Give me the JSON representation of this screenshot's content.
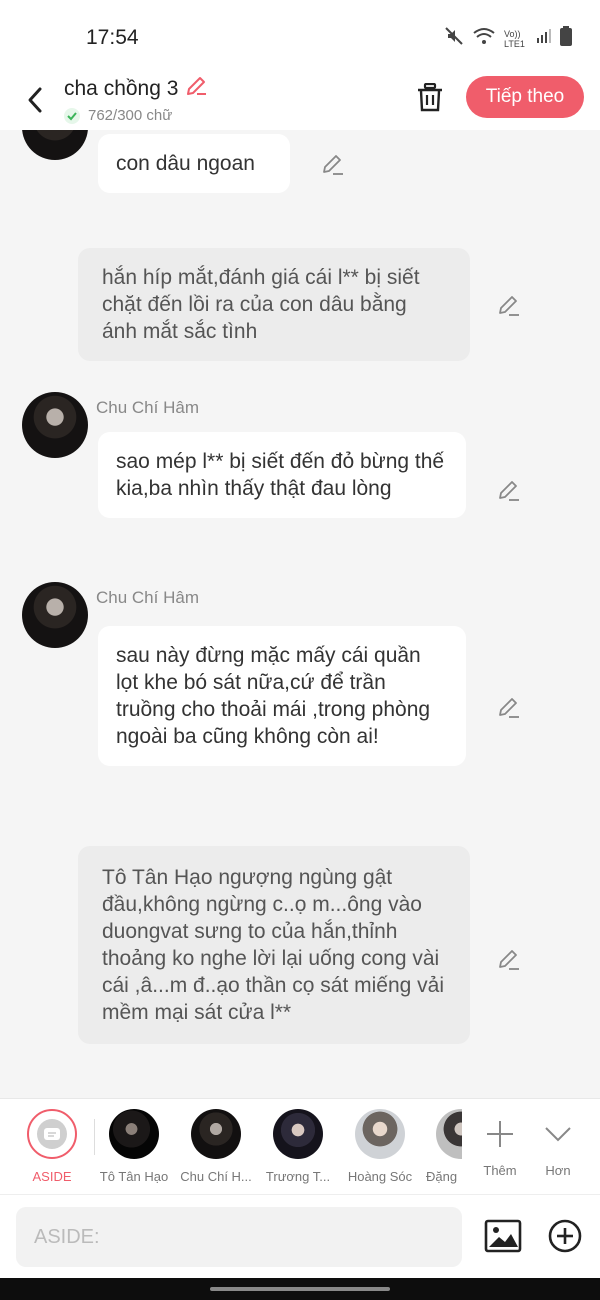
{
  "status_bar": {
    "time": "17:54",
    "network": "Vo)) LTE1"
  },
  "header": {
    "title": "cha chồng 3",
    "word_count": "762/300 chữ",
    "next_label": "Tiếp theo"
  },
  "messages": [
    {
      "type": "character",
      "text": "con dâu ngoan"
    },
    {
      "type": "narration",
      "text": "hắn híp mắt,đánh giá cái l** bị siết chặt đến lồi ra của con dâu bằng ánh mắt sắc tình"
    },
    {
      "type": "character",
      "sender": "Chu Chí Hâm",
      "text": "sao mép l** bị siết đến đỏ bừng thế kia,ba nhìn thấy thật đau lòng"
    },
    {
      "type": "character",
      "sender": "Chu Chí Hâm",
      "text": "sau này đừng mặc mấy cái quần lọt khe bó sát nữa,cứ để trần truồng cho thoải mái ,trong phòng ngoài ba cũng không còn ai!"
    },
    {
      "type": "narration",
      "text": "Tô Tân Hạo ngượng ngùng gật đầu,không ngừng c..ọ m...ông vào duongvat sưng to của hắn,thỉnh thoảng ko nghe lời lại uống cong vài cái ,â...m đ..ạo thần cọ sát miếng vải mềm mại sát cửa l**"
    }
  ],
  "characters": [
    {
      "label": "ASIDE"
    },
    {
      "label": "Tô Tân Hạo"
    },
    {
      "label": "Chu Chí H..."
    },
    {
      "label": "Trương T..."
    },
    {
      "label": "Hoàng Sóc"
    },
    {
      "label": "Đặng"
    }
  ],
  "char_actions": {
    "add_label": "Thêm",
    "more_label": "Hơn"
  },
  "input": {
    "placeholder": "ASIDE:"
  },
  "colors": {
    "accent": "#f05d6b",
    "bubble": "#ffffff",
    "narration": "#ececec",
    "background": "#f5f5f5"
  }
}
